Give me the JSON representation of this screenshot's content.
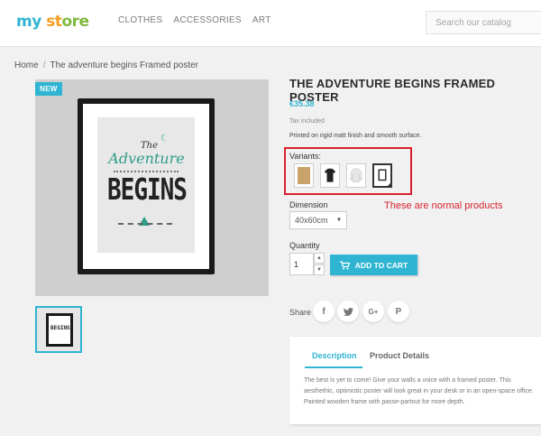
{
  "header": {
    "logo_parts": [
      "my",
      " ",
      "st",
      "ore"
    ],
    "nav": [
      "CLOTHES",
      "ACCESSORIES",
      "ART"
    ],
    "search_placeholder": "Search our catalog"
  },
  "breadcrumb": [
    "Home",
    "/",
    "The adventure begins Framed poster"
  ],
  "product_image": {
    "badge": "NEW",
    "poster_lines": [
      "The",
      "Adventure",
      "BEGINS"
    ],
    "thumbnail_text": "BEGINS"
  },
  "product": {
    "title": "THE ADVENTURE BEGINS FRAMED POSTER",
    "price": "€35.38",
    "tax_label": "Tax included",
    "short_description": "Printed on rigid matt finish and smooth surface.",
    "variants_label": "Variants:",
    "variants": [
      {
        "name": "poster-variant-icon",
        "color": "#c9a36b"
      },
      {
        "name": "tshirt-variant-icon",
        "color": "#222222"
      },
      {
        "name": "sweater-variant-icon",
        "color": "#e6e6e6"
      },
      {
        "name": "framed-poster-variant-icon",
        "color": "#333333",
        "selected": true
      }
    ],
    "annotation": "These are normal products",
    "dimension_label": "Dimension",
    "dimension_value": "40x60cm",
    "quantity_label": "Quantity",
    "quantity_value": "1",
    "add_to_cart": "ADD TO CART",
    "share_label": "Share",
    "share_icons": [
      "f",
      "t",
      "G+",
      "P"
    ]
  },
  "tabs": {
    "items": [
      "Description",
      "Product Details"
    ],
    "description": "The best is yet to come! Give your walls a voice with a framed poster. This aesthethic, optimistic poster will look great in your desk or in an open-space office. Painted wooden frame with passe-partout for more depth."
  },
  "colors": {
    "accent": "#2fb5d2",
    "highlight_box": "#d8222f"
  }
}
